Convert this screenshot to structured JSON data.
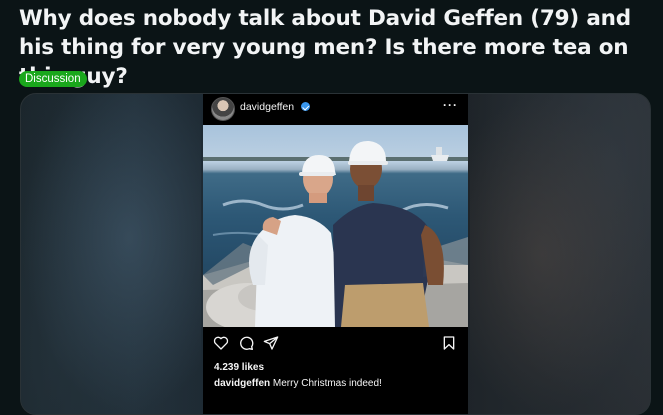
{
  "post": {
    "title": "Why does nobody talk about David Geffen (79) and his thing for very young men? Is there more tea on this guy?",
    "flair": "Discussion",
    "flair_color": "#1aa71c"
  },
  "instagram": {
    "username": "davidgeffen",
    "verified_icon": "verified-badge-icon",
    "more_icon": "more-options-icon",
    "more_glyph": "···",
    "likes": "4.239 likes",
    "caption_user": "davidgeffen",
    "caption_text": " Merry Christmas indeed!",
    "actions": [
      "heart-icon",
      "comment-icon",
      "share-icon",
      "bookmark-icon"
    ]
  },
  "colors": {
    "background": "#0b1416",
    "title_text": "#f2f4f5",
    "instagram_bg": "#000000",
    "verified_blue": "#3897f0"
  }
}
